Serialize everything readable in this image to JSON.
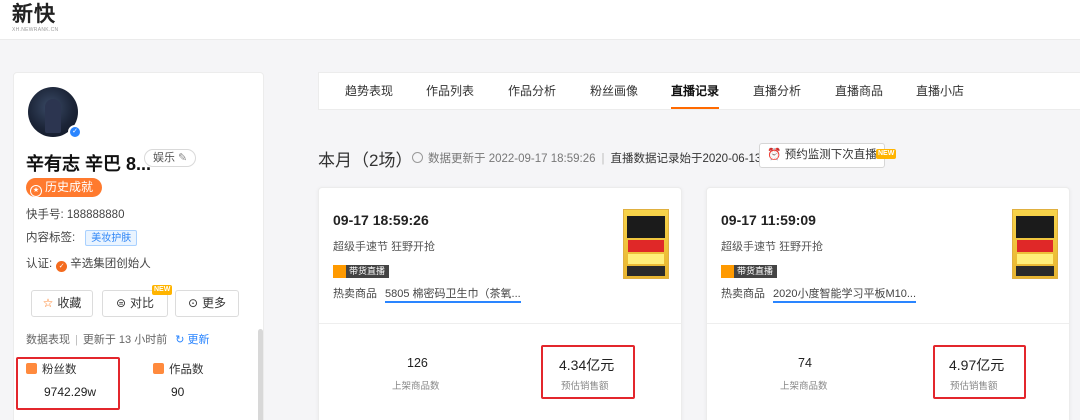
{
  "logo": {
    "main": "新快",
    "sub": "XH.NEWRANK.CN"
  },
  "profile": {
    "name": "辛有志 辛巴 8...",
    "category_tag": "娱乐",
    "honor_label": "历史成就",
    "kuaishou_id_label": "快手号:",
    "kuaishou_id": "188888880",
    "content_tag_label": "内容标签:",
    "content_tag": "美妆护肤",
    "cert_label": "认证:",
    "cert_text": "辛选集团创始人",
    "actions": [
      {
        "label": "收藏",
        "icon": "star-icon"
      },
      {
        "label": "对比",
        "icon": "compare-icon"
      },
      {
        "label": "更多",
        "icon": "more-icon"
      }
    ],
    "compare_new_badge": "NEW",
    "data_perf_label": "数据表现",
    "update_text": "更新于 13 小时前",
    "refresh_label": "更新",
    "stats": [
      {
        "label": "粉丝数",
        "value": "9742.29w",
        "icon": "fans-icon"
      },
      {
        "label": "作品数",
        "value": "90",
        "icon": "works-icon"
      }
    ]
  },
  "tabs": [
    {
      "label": "趋势表现",
      "active": false
    },
    {
      "label": "作品列表",
      "active": false
    },
    {
      "label": "作品分析",
      "active": false
    },
    {
      "label": "粉丝画像",
      "active": false
    },
    {
      "label": "直播记录",
      "active": true
    },
    {
      "label": "直播分析",
      "active": false
    },
    {
      "label": "直播商品",
      "active": false
    },
    {
      "label": "直播小店",
      "active": false
    }
  ],
  "month": {
    "title": "本月（2场）",
    "data_update_text": "数据更新于 2022-09-17 18:59:26",
    "record_start_text": "直播数据记录始于2020-06-13",
    "monitor_button": "预约监测下次直播",
    "monitor_new_badge": "NEW"
  },
  "live_cards": [
    {
      "time": "09-17 18:59:26",
      "subtitle": "超级手速节 狂野开抢",
      "badge": "带货直播",
      "hot_label": "热卖商品",
      "hot_product": "5805 棉密码卫生巾（茶氧...",
      "products_count": "126",
      "products_label": "上架商品数",
      "sales": "4.34亿元",
      "sales_label": "预估销售额"
    },
    {
      "time": "09-17 11:59:09",
      "subtitle": "超级手速节 狂野开抢",
      "badge": "带货直播",
      "hot_label": "热卖商品",
      "hot_product": "2020小度智能学习平板M10...",
      "products_count": "74",
      "products_label": "上架商品数",
      "sales": "4.97亿元",
      "sales_label": "预估销售额"
    }
  ],
  "colors": {
    "accent_orange": "#ff6a00",
    "link_blue": "#2a85ff",
    "highlight_red": "#e3262c",
    "new_badge": "#ffb400"
  }
}
